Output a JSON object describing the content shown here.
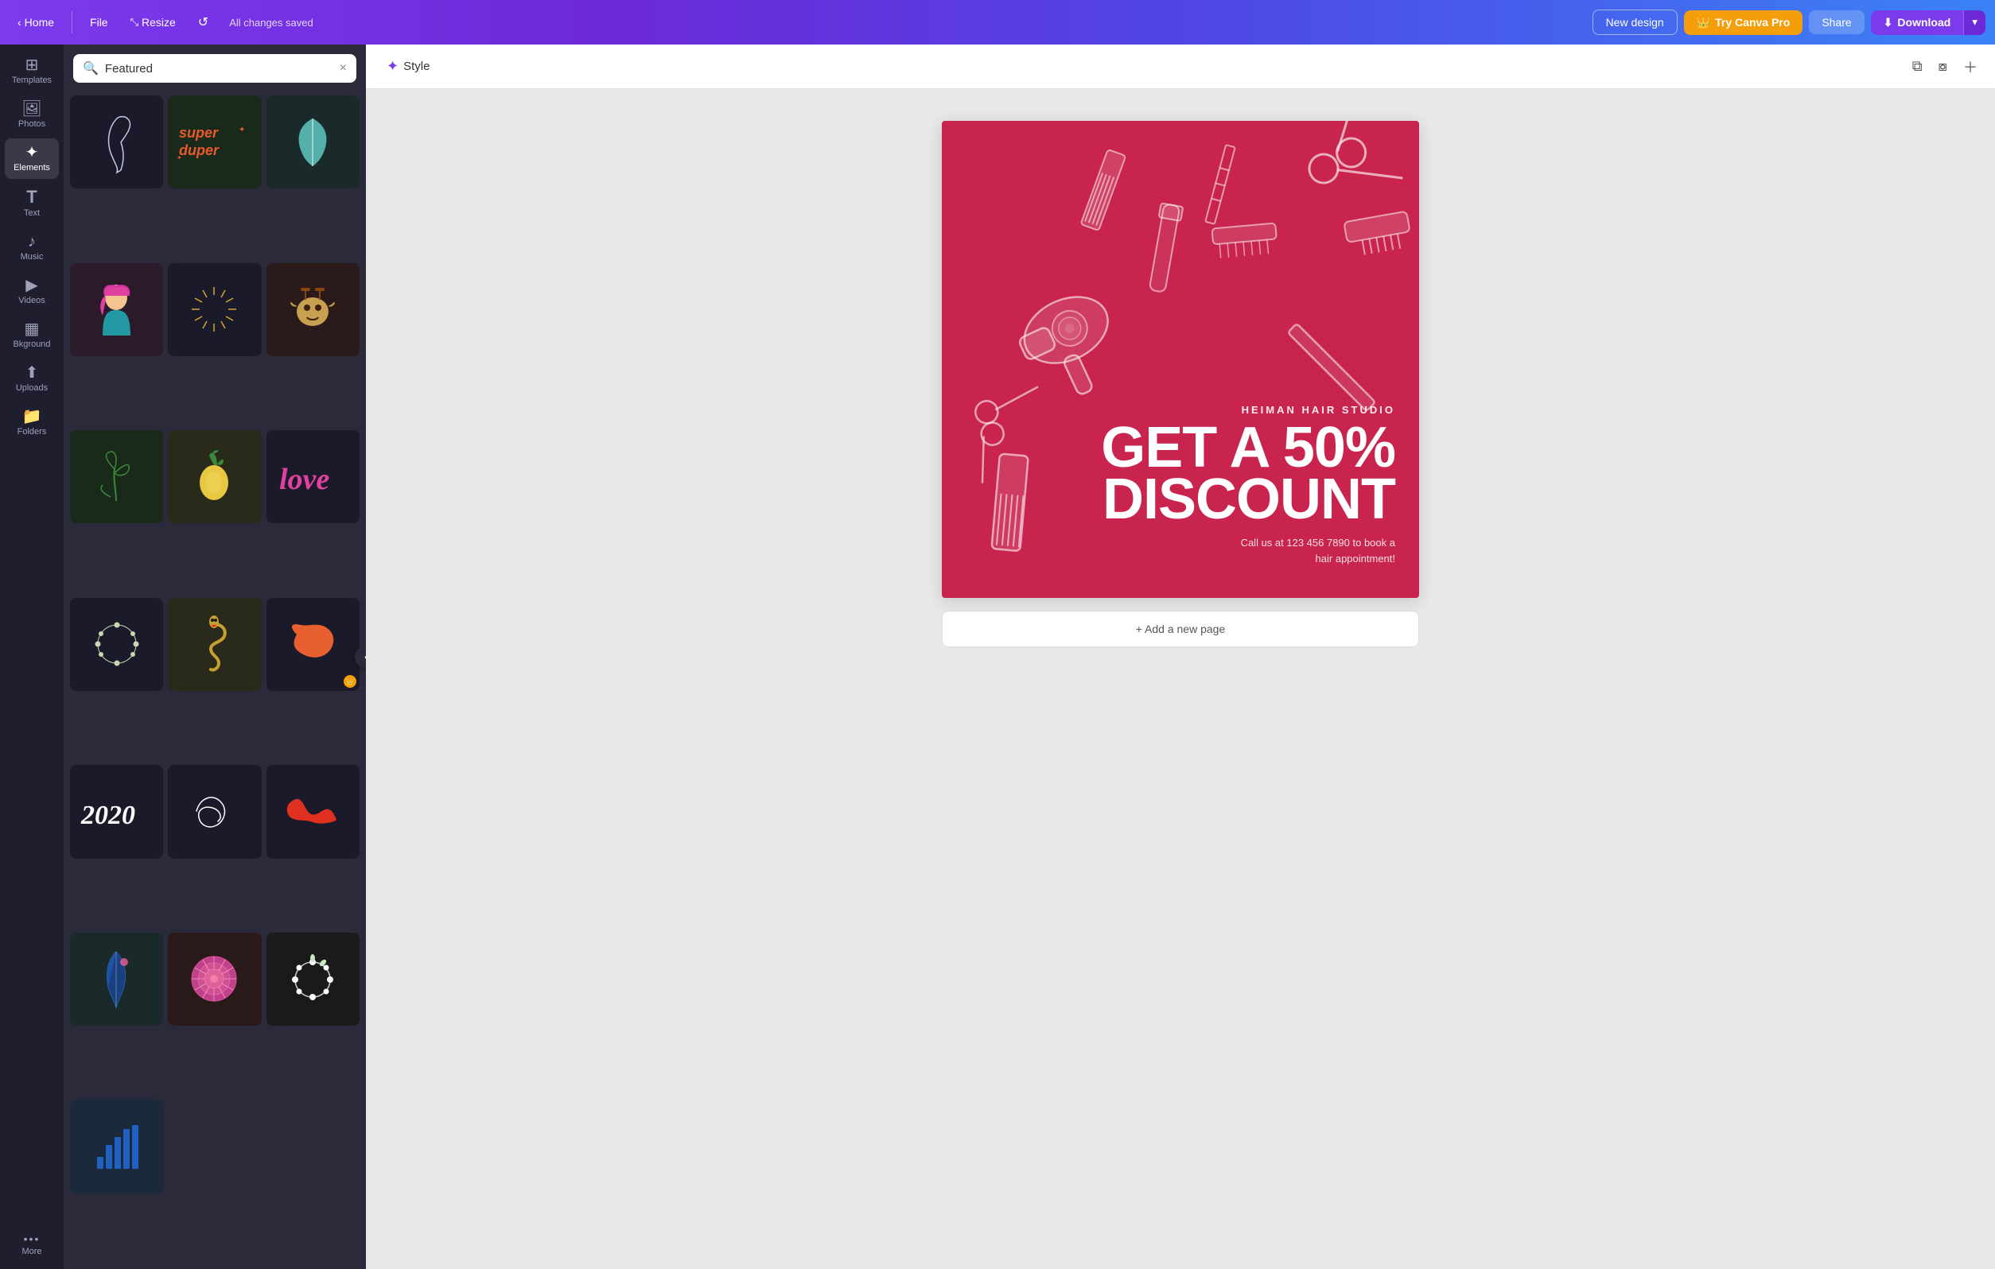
{
  "nav": {
    "home_label": "Home",
    "file_label": "File",
    "resize_label": "Resize",
    "saved_label": "All changes saved",
    "new_design_label": "New design",
    "try_pro_label": "Try Canva Pro",
    "share_label": "Share",
    "download_label": "Download"
  },
  "sidebar": {
    "items": [
      {
        "id": "templates",
        "label": "Templates",
        "icon": "⊞"
      },
      {
        "id": "photos",
        "label": "Photos",
        "icon": "🖼"
      },
      {
        "id": "elements",
        "label": "Elements",
        "icon": "✦"
      },
      {
        "id": "text",
        "label": "Text",
        "icon": "T"
      },
      {
        "id": "music",
        "label": "Music",
        "icon": "♪"
      },
      {
        "id": "videos",
        "label": "Videos",
        "icon": "▶"
      },
      {
        "id": "background",
        "label": "Bkground",
        "icon": "⬛"
      },
      {
        "id": "uploads",
        "label": "Uploads",
        "icon": "⬆"
      },
      {
        "id": "folders",
        "label": "Folders",
        "icon": "📁"
      },
      {
        "id": "more",
        "label": "More",
        "icon": "•••"
      }
    ]
  },
  "panel": {
    "search_value": "Featured",
    "search_placeholder": "Featured",
    "clear_label": "×"
  },
  "toolbar": {
    "style_label": "Style",
    "add_page_label": "+ Add a new page"
  },
  "card": {
    "studio_name": "HEIMAN HAIR STUDIO",
    "headline_line1": "GET A 50%",
    "headline_line2": "DISCOUNT",
    "contact": "Call us at 123 456 7890 to book a\nhair appointment!"
  },
  "colors": {
    "card_bg": "#c8244e",
    "nav_start": "#7c3aed",
    "nav_end": "#3b82f6",
    "panel_bg": "#2a2a3a",
    "sidebar_bg": "#1e1e2e"
  }
}
